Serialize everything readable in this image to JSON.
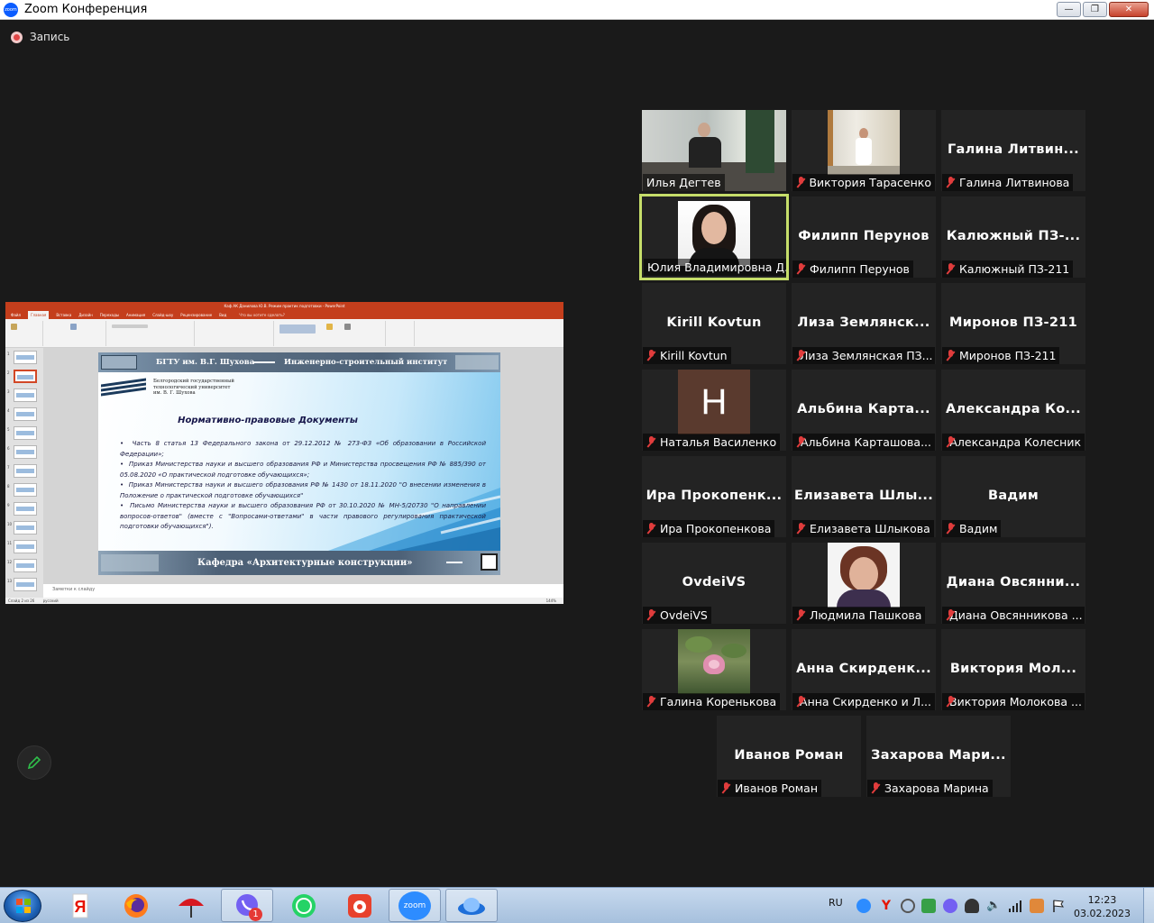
{
  "window": {
    "title": "Zoom Конференция",
    "logo_text": "zoom"
  },
  "recording": {
    "label": "Запись"
  },
  "share": {
    "ppt_title": "Каф АК Данилова Ю.В. Режим практик подготовки - PowerPoint",
    "ppt_tabs": [
      "Файл",
      "Главная",
      "Вставка",
      "Дизайн",
      "Переходы",
      "Анимация",
      "Слайд-шоу",
      "Рецензирование",
      "Вид"
    ],
    "ppt_tell_me": "Что вы хотите сделать?",
    "slide_numbers": [
      "1",
      "2",
      "3",
      "4",
      "5",
      "6",
      "7",
      "8",
      "9",
      "10",
      "11",
      "12",
      "13"
    ],
    "notes_placeholder": "Заметки к слайду",
    "status_left": "Слайд 2 из 26",
    "status_lang": "русский",
    "zoom_level": "144%",
    "slide": {
      "banner_left": "БГТУ им. В.Г. Шухова",
      "banner_right": "Инженерно-строительный институт",
      "univ": [
        "Белгородский государственный",
        "технологический университет",
        "им. В. Г. Шухова"
      ],
      "heading": "Нормативно-правовые Документы",
      "bullets": [
        "Часть 8 статья 13 Федерального закона от 29.12.2012 № 273-ФЗ «Об образовании в Российской Федерации»;",
        "Приказ Министерства науки и высшего образования РФ и Министерства просвещения РФ № 885/390 от 05.08.2020 «О практической подготовке обучающихся»;",
        "Приказ Министерства науки и высшего образования РФ № 1430 от 18.11.2020 \"О внесении изменения в Положение о практической подготовке обучающихся\"",
        "Письмо Министерства науки и высшего образования РФ от 30.10.2020 № МН-5/20730 \"О направлении вопросов-ответов\" (вместе с \"Вопросами-ответами\" в части правового регулирования практической подготовки обучающихся\")."
      ],
      "footer": "Кафедра «Архитектурные конструкции»"
    }
  },
  "participants": [
    {
      "big": "",
      "name": "Илья Дегтев",
      "muted": false,
      "photo": "classroom"
    },
    {
      "big": "",
      "name": "Виктория Тарасенко",
      "muted": true,
      "photo": "room"
    },
    {
      "big": "Галина Литвин...",
      "name": "Галина Литвинова",
      "muted": true
    },
    {
      "big": "",
      "name": "Юлия Владимировна Д...",
      "muted": false,
      "photo": "woman",
      "active": true
    },
    {
      "big": "Филипп Перунов",
      "name": "Филипп Перунов",
      "muted": true
    },
    {
      "big": "Калюжный ПЗ-...",
      "name": "Калюжный ПЗ-211",
      "muted": true
    },
    {
      "big": "Kirill Kovtun",
      "name": "Kirill Kovtun",
      "muted": true
    },
    {
      "big": "Лиза Землянск...",
      "name": "Лиза Землянская ПЗ...",
      "muted": true
    },
    {
      "big": "Миронов ПЗ-211",
      "name": "Миронов ПЗ-211",
      "muted": true
    },
    {
      "big": "",
      "name": "Наталья Василенко",
      "muted": true,
      "letter": "H"
    },
    {
      "big": "Альбина Карта...",
      "name": "Альбина Карташова...",
      "muted": true
    },
    {
      "big": "Александра Ко...",
      "name": "Александра Колесник",
      "muted": true
    },
    {
      "big": "Ира Прокопенк...",
      "name": "Ира Прокопенкова",
      "muted": true
    },
    {
      "big": "Елизавета Шлы...",
      "name": "Елизавета Шлыкова",
      "muted": true
    },
    {
      "big": "Вадим",
      "name": "Вадим",
      "muted": true
    },
    {
      "big": "OvdeiVS",
      "name": "OvdeiVS",
      "muted": true
    },
    {
      "big": "",
      "name": "Людмила Пашкова",
      "muted": true,
      "photo": "woman2"
    },
    {
      "big": "Диана Овсянни...",
      "name": "Диана Овсянникова ...",
      "muted": true
    },
    {
      "big": "",
      "name": "Галина Коренькова",
      "muted": true,
      "photo": "lotus"
    },
    {
      "big": "Анна Скирденк...",
      "name": "Анна Скирденко и Л...",
      "muted": true
    },
    {
      "big": "Виктория Мол...",
      "name": "Виктория Молокова ...",
      "muted": true
    },
    {
      "big": "Иванов Роман",
      "name": "Иванов Роман",
      "muted": true
    },
    {
      "big": "Захарова Мари...",
      "name": "Захарова Марина",
      "muted": true
    }
  ],
  "taskbar": {
    "apps": [
      "yandex-browser",
      "firefox",
      "umbrella",
      "viber",
      "whatsapp",
      "record-app",
      "zoom",
      "zoom-meetings"
    ],
    "viber_badge": "1",
    "zoom_label": "zoom",
    "lang": "RU",
    "time": "12:23",
    "date": "03.02.2023"
  }
}
